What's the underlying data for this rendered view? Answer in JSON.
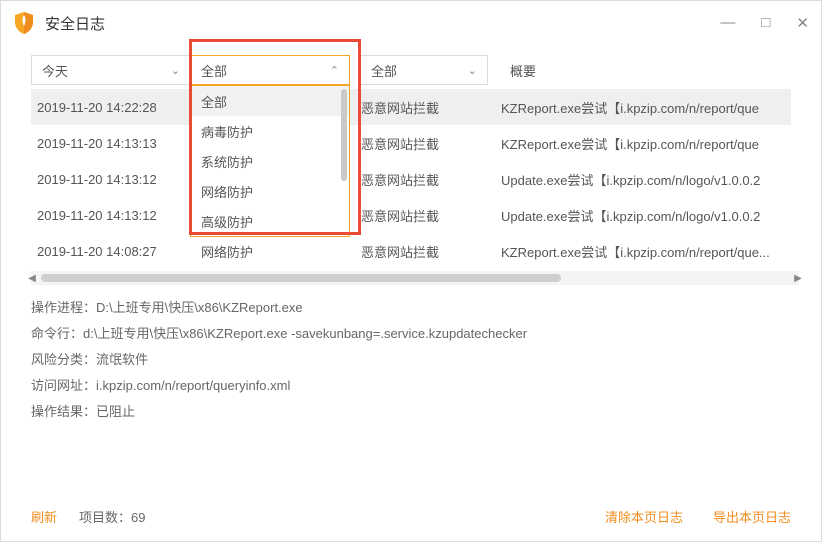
{
  "title": "安全日志",
  "win_controls": {
    "min": "—",
    "max": "□",
    "close": "✕"
  },
  "filters": {
    "time": {
      "value": "今天"
    },
    "type_dd": {
      "value": "全部",
      "options": [
        "全部",
        "病毒防护",
        "系统防护",
        "网络防护",
        "高级防护"
      ]
    },
    "event": {
      "value": "全部"
    },
    "summary_header": "概要"
  },
  "rows": [
    {
      "time": "2019-11-20 14:22:28",
      "type": "",
      "event": "恶意网站拦截",
      "summary": "KZReport.exe尝试【i.kpzip.com/n/report/que"
    },
    {
      "time": "2019-11-20 14:13:13",
      "type": "",
      "event": "恶意网站拦截",
      "summary": "KZReport.exe尝试【i.kpzip.com/n/report/que"
    },
    {
      "time": "2019-11-20 14:13:12",
      "type": "",
      "event": "恶意网站拦截",
      "summary": "Update.exe尝试【i.kpzip.com/n/logo/v1.0.0.2"
    },
    {
      "time": "2019-11-20 14:13:12",
      "type": "",
      "event": "恶意网站拦截",
      "summary": "Update.exe尝试【i.kpzip.com/n/logo/v1.0.0.2"
    },
    {
      "time": "2019-11-20 14:08:27",
      "type": "网络防护",
      "event": "恶意网站拦截",
      "summary": "KZReport.exe尝试【i.kpzip.com/n/report/que..."
    }
  ],
  "details": {
    "process_label": "操作进程：",
    "process": "D:\\上班专用\\快压\\x86\\KZReport.exe",
    "cmd_label": "命令行：",
    "cmd": "d:\\上班专用\\快压\\x86\\KZReport.exe -savekunbang=.service.kzupdatechecker",
    "risk_label": "风险分类：",
    "risk": "流氓软件",
    "url_label": "访问网址：",
    "url": "i.kpzip.com/n/report/queryinfo.xml",
    "result_label": "操作结果：",
    "result": "已阻止"
  },
  "footer": {
    "refresh": "刷新",
    "count_label": "项目数：",
    "count": "69",
    "clear": "清除本页日志",
    "export": "导出本页日志"
  }
}
